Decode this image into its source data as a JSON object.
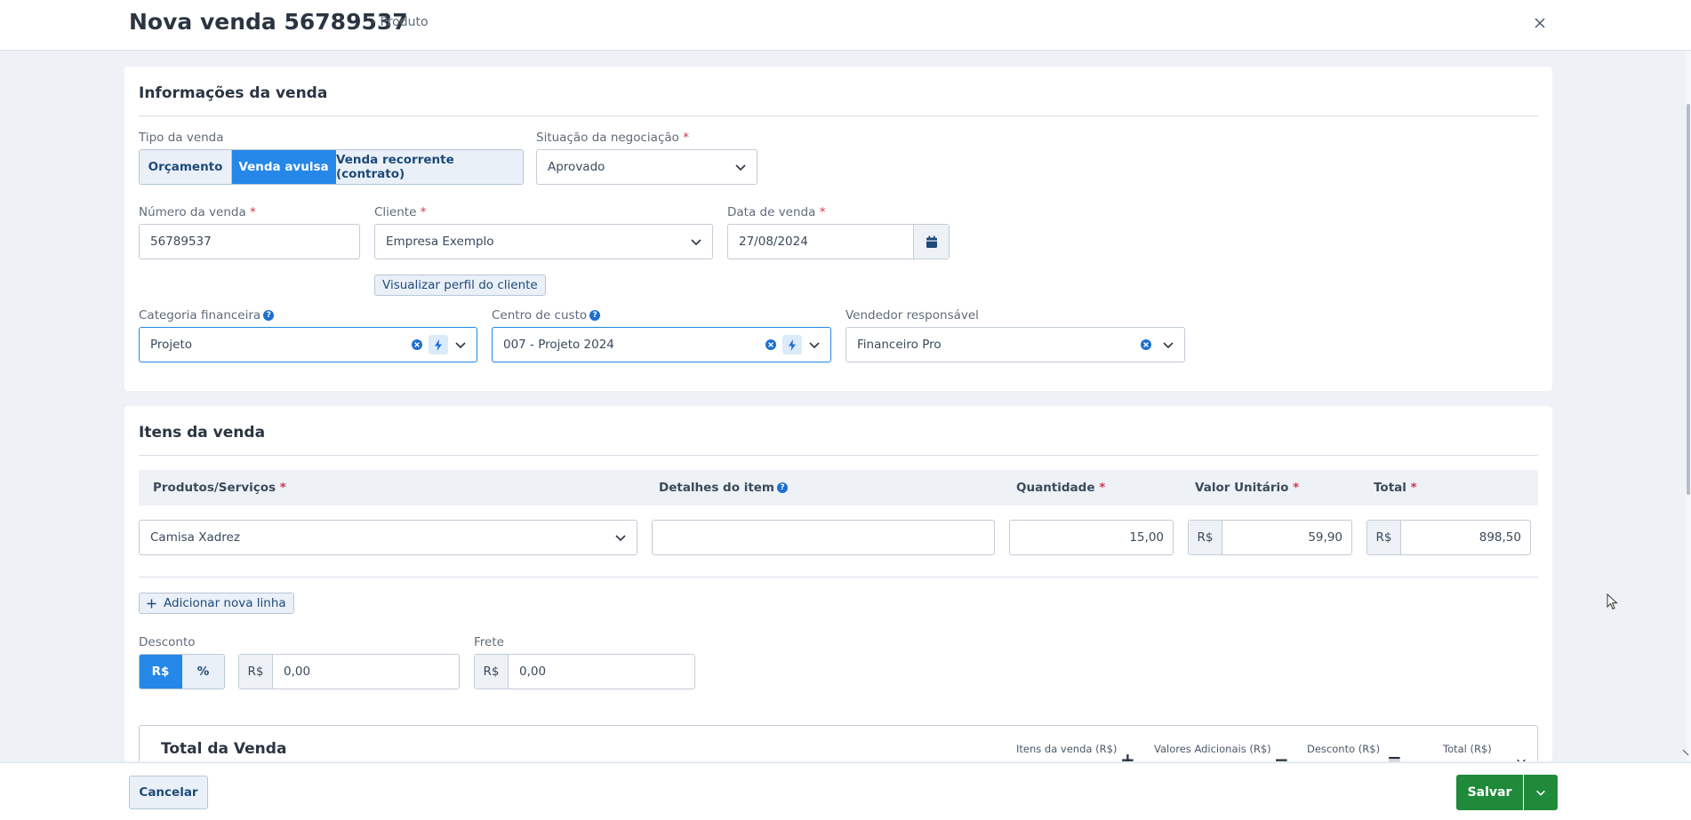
{
  "header": {
    "title": "Nova venda 56789537",
    "subtitle": "- Produto"
  },
  "info": {
    "section_title": "Informações da venda",
    "tipo_label": "Tipo da venda",
    "tipo_options": [
      "Orçamento",
      "Venda avulsa",
      "Venda recorrente (contrato)"
    ],
    "tipo_selected": "Venda avulsa",
    "situacao_label": "Situação da negociação",
    "situacao_value": "Aprovado",
    "numero_label": "Número da venda",
    "numero_value": "56789537",
    "cliente_label": "Cliente",
    "cliente_value": "Empresa Exemplo",
    "perfil_link": "Visualizar perfil do cliente",
    "data_label": "Data de venda",
    "data_value": "27/08/2024",
    "categoria_label": "Categoria financeira",
    "categoria_value": "Projeto",
    "centro_label": "Centro de custo",
    "centro_value": "007 - Projeto 2024",
    "vendedor_label": "Vendedor responsável",
    "vendedor_value": "Financeiro Pro",
    "required_mark": "*"
  },
  "items": {
    "section_title": "Itens da venda",
    "columns": {
      "produto": "Produtos/Serviços",
      "detalhes": "Detalhes do item",
      "quantidade": "Quantidade",
      "valor_unitario": "Valor Unitário",
      "total": "Total"
    },
    "row": {
      "produto": "Camisa Xadrez",
      "detalhes": "",
      "quantidade": "15,00",
      "currency": "R$",
      "valor_unitario": "59,90",
      "total": "898,50"
    },
    "add_line": "Adicionar nova linha",
    "desconto_label": "Desconto",
    "desconto_modes": [
      "R$",
      "%"
    ],
    "desconto_currency": "R$",
    "desconto_value": "0,00",
    "frete_label": "Frete",
    "frete_currency": "R$",
    "frete_value": "0,00"
  },
  "total_venda": {
    "title": "Total da Venda",
    "col_itens": "Itens da venda (R$)",
    "col_adicionais": "Valores Adicionais (R$)",
    "col_desconto": "Desconto (R$)",
    "col_total": "Total (R$)",
    "op_plus": "+",
    "op_minus": "−",
    "op_equals": "="
  },
  "footer": {
    "cancel_label": "Cancelar",
    "save_label": "Salvar"
  },
  "colors": {
    "primary": "#2587e8",
    "success": "#1f8a3a",
    "required": "#d0384f"
  },
  "icons": [
    "close-icon",
    "chevron-down-icon",
    "calendar-icon",
    "clear-icon",
    "bolt-icon",
    "help-icon",
    "plus-icon"
  ]
}
